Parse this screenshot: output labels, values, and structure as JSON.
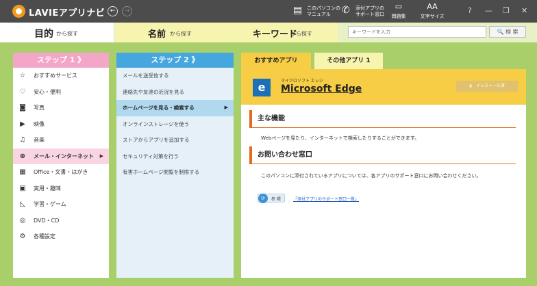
{
  "titlebar": {
    "app_title": "LAVIEアプリナビ",
    "back_glyph": "←",
    "forward_glyph": "→",
    "tools": [
      {
        "icon": "▤",
        "label1": "このパソコンの",
        "label2": "マニュアル"
      },
      {
        "icon": "✆",
        "label1": "添付アプリの",
        "label2": "サポート窓口"
      },
      {
        "icon": "▭",
        "label1": "",
        "label2": "問題集"
      },
      {
        "icon": "AA",
        "label1": "",
        "label2": "文字サイズ"
      }
    ],
    "window_buttons": {
      "help": "?",
      "minimize": "—",
      "restore": "❐",
      "close": "✕"
    }
  },
  "main_tabs": [
    {
      "label": "目的",
      "sub": "から探す"
    },
    {
      "label": "名前",
      "sub": "から探す"
    },
    {
      "label": "キーワード",
      "sub": "から探す"
    }
  ],
  "search": {
    "placeholder": "キーワードを入力",
    "button": "検 索",
    "button_icon": "🔍"
  },
  "step1": {
    "title": "ステップ 1 》",
    "items": [
      {
        "icon": "☆",
        "label": "おすすめサービス"
      },
      {
        "icon": "♡",
        "label": "安心・便利"
      },
      {
        "icon": "◙",
        "label": "写真"
      },
      {
        "icon": "▶",
        "label": "映像"
      },
      {
        "icon": "♫",
        "label": "音楽"
      },
      {
        "icon": "⊕",
        "label": "メール・インターネット"
      },
      {
        "icon": "▦",
        "label": "Office・文書・はがき"
      },
      {
        "icon": "▣",
        "label": "実用・趣味"
      },
      {
        "icon": "◺",
        "label": "学習・ゲーム"
      },
      {
        "icon": "◎",
        "label": "DVD・CD"
      },
      {
        "icon": "⚙",
        "label": "各種設定"
      }
    ],
    "active_arrow": "▶"
  },
  "step2": {
    "title": "ステップ 2 》",
    "items": [
      "メールを送受信する",
      "連絡先や友達の近況を見る",
      "ホームページを見る・検索する",
      "オンラインストレージを使う",
      "ストアからアプリを追加する",
      "セキュリティ対策を行う",
      "有害ホームページ閲覧を制限する"
    ],
    "active_arrow": "▶"
  },
  "detail": {
    "tabs": [
      {
        "label": "おすすめアプリ"
      },
      {
        "label": "その他アプリ 1"
      }
    ],
    "app": {
      "icon_letter": "e",
      "kana": "マイクロソフト エッジ",
      "name": "Microsoft Edge",
      "installed_label": "⧗　インストール済"
    },
    "features_heading": "主な機能",
    "features_text": "Webページを見たり、インターネットで検索したりすることができます。",
    "inquiry_heading": "お問い合わせ窓口",
    "inquiry_text": "このパソコンに添付されているアプリについては、各アプリのサポート窓口にお問い合わせください。",
    "ref_icon": "⟳",
    "ref_label": "参 照",
    "ref_link": "「添付アプリのサポート窓口一覧」"
  },
  "colors": {
    "background": "#a9cf6b",
    "titlebar": "#4c4c4c",
    "step1_header": "#f4a6c8",
    "step2_header": "#45a7dd",
    "accent_yellow": "#f6cd45",
    "section_orange": "#e46b1e"
  }
}
